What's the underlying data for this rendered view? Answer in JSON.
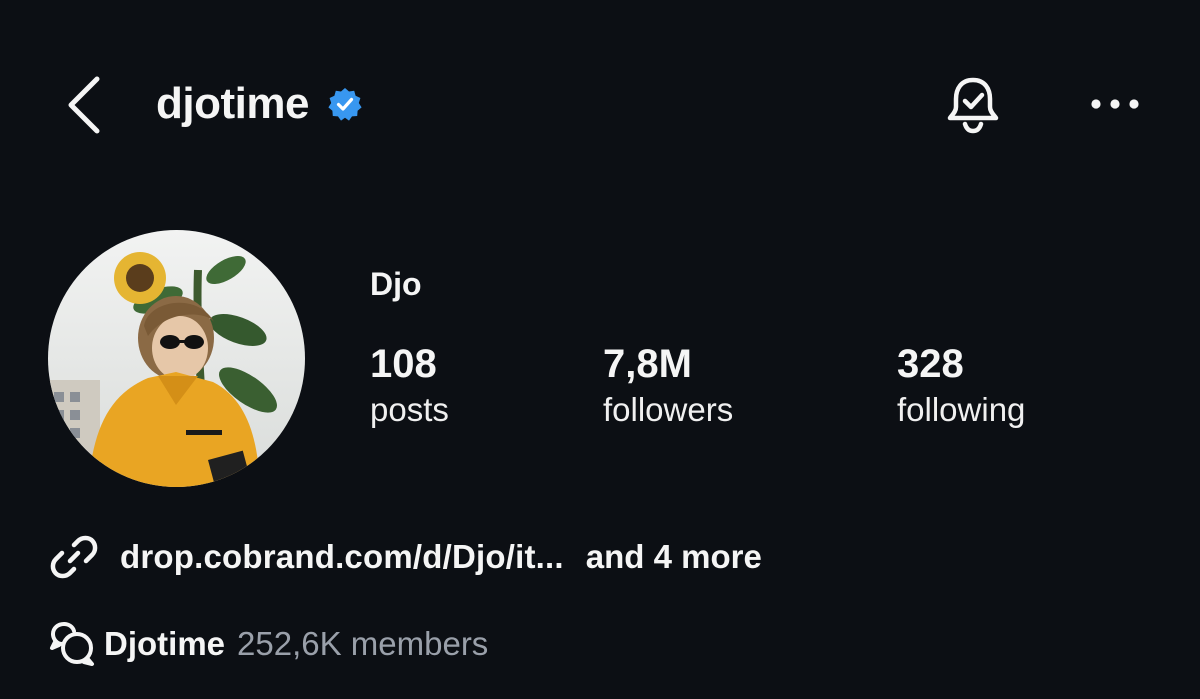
{
  "header": {
    "username": "djotime",
    "verified": true,
    "accent_color": "#3897f0"
  },
  "icons": {
    "back": "chevron-left-icon",
    "verified": "verified-badge-icon",
    "notifications": "bell-check-icon",
    "more": "more-horizontal-icon",
    "link": "link-icon",
    "community": "chat-bubbles-icon"
  },
  "profile": {
    "display_name": "Djo",
    "stats": [
      {
        "value": "108",
        "label": "posts"
      },
      {
        "value": "7,8M",
        "label": "followers"
      },
      {
        "value": "328",
        "label": "following"
      }
    ]
  },
  "links": {
    "url": "drop.cobrand.com/d/Djo/it...",
    "more": "and 4 more"
  },
  "community": {
    "name": "Djotime",
    "members": "252,6K members"
  },
  "colors": {
    "background": "#0c0f14",
    "text": "#f5f5f5",
    "muted": "#9aa0aa"
  }
}
